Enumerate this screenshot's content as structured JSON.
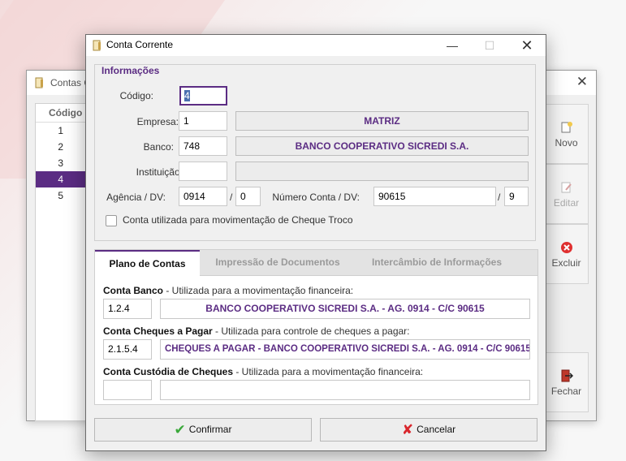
{
  "background_window": {
    "title": "Contas Co",
    "list_header": "Código",
    "rows": [
      "1",
      "2",
      "3",
      "4",
      "5"
    ],
    "selected_row": "4",
    "buttons": {
      "novo": "Novo",
      "editar": "Editar",
      "excluir": "Excluir",
      "fechar": "Fechar"
    }
  },
  "dialog": {
    "title": "Conta Corrente",
    "section_title": "Informações",
    "fields": {
      "codigo": {
        "label": "Código:",
        "value": "4"
      },
      "empresa": {
        "label": "Empresa:",
        "value": "1",
        "name": "MATRIZ"
      },
      "banco": {
        "label": "Banco:",
        "value": "748",
        "name": "BANCO COOPERATIVO SICREDI S.A."
      },
      "instituicao": {
        "label": "Instituição:",
        "value": "",
        "name": ""
      },
      "agencia": {
        "label": "Agência / DV:",
        "value": "0914",
        "dv": "0"
      },
      "numero_conta": {
        "label": "Número Conta / DV:",
        "value": "90615",
        "dv": "9"
      }
    },
    "separator": "/",
    "cheque_troco": {
      "label": "Conta utilizada para movimentação de Cheque Troco",
      "checked": false
    },
    "tabs": [
      "Plano de Contas",
      "Impressão de Documentos",
      "Intercâmbio de Informações"
    ],
    "active_tab": "Plano de Contas",
    "accounts": [
      {
        "title": "Conta Banco",
        "desc": " - Utilizada para a movimentação financeira:",
        "code": "1.2.4",
        "name": "BANCO COOPERATIVO SICREDI S.A. - AG. 0914 - C/C 90615"
      },
      {
        "title": "Conta Cheques a Pagar",
        "desc": " - Utilizada para controle de cheques a pagar:",
        "code": "2.1.5.4",
        "name": "CHEQUES A PAGAR - BANCO COOPERATIVO SICREDI S.A. - AG. 0914 - C/C 90615"
      },
      {
        "title": "Conta Custódia de Cheques",
        "desc": " - Utilizada para a movimentação financeira:",
        "code": "",
        "name": ""
      }
    ],
    "buttons": {
      "confirm": "Confirmar",
      "cancel": "Cancelar"
    }
  },
  "colors": {
    "accent": "#5b2c83",
    "confirm_icon": "#3aa83a",
    "cancel_icon": "#d9262c"
  }
}
